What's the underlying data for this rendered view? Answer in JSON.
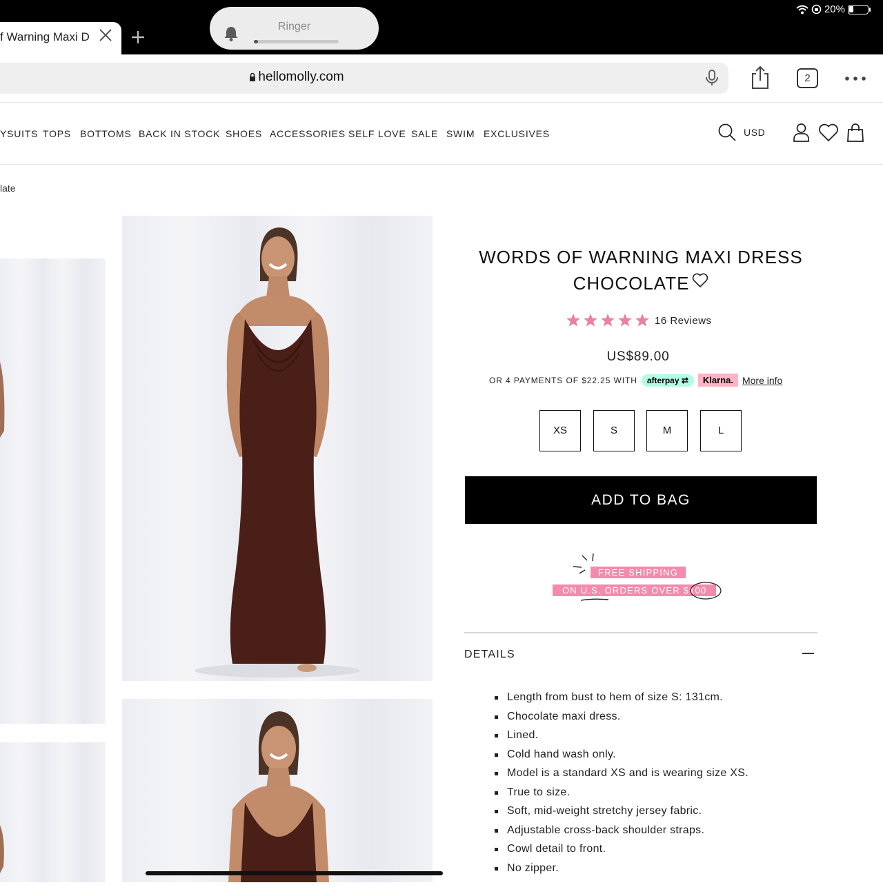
{
  "status_bar": {
    "battery": "20%"
  },
  "ringer": {
    "label": "Ringer",
    "level": 0.05
  },
  "browser": {
    "tab_title": "f Warning Maxi D",
    "url": "hellomolly.com",
    "tab_count": "2"
  },
  "nav": {
    "items": [
      "YSUITS",
      "TOPS",
      "BOTTOMS",
      "BACK IN STOCK",
      "SHOES",
      "ACCESSORIES",
      "SELF LOVE",
      "SALE",
      "SWIM",
      "EXCLUSIVES"
    ],
    "currency": "USD"
  },
  "breadcrumb": "late",
  "product": {
    "title_line1": "WORDS OF WARNING MAXI DRESS",
    "title_line2": "CHOCOLATE",
    "rating": 5,
    "reviews": "16 Reviews",
    "price": "US$89.00",
    "payments_text": "OR 4 PAYMENTS OF $22.25 WITH",
    "afterpay_label": "afterpay",
    "klarna_label": "Klarna.",
    "more_info": "More info",
    "sizes": [
      "XS",
      "S",
      "M",
      "L"
    ],
    "add_to_bag": "ADD TO BAG",
    "shipping_line1": "FREE SHIPPING",
    "shipping_line2": "ON U.S. ORDERS OVER $100",
    "details_heading": "DETAILS",
    "details": [
      "Length from bust to hem of size S: 131cm.",
      "Chocolate maxi dress.",
      "Lined.",
      "Cold hand wash only.",
      "Model is a standard XS and is wearing size XS.",
      "True to size.",
      "Soft, mid-weight stretchy jersey fabric.",
      "Adjustable cross-back shoulder straps.",
      "Cowl detail to front.",
      "No zipper."
    ]
  },
  "colors": {
    "accent_pink": "#f48aae",
    "star_pink": "#ec7fa5",
    "dress_brown": "#4a1f18",
    "afterpay_mint": "#b2fce4",
    "klarna_pink": "#ffb3c7"
  }
}
